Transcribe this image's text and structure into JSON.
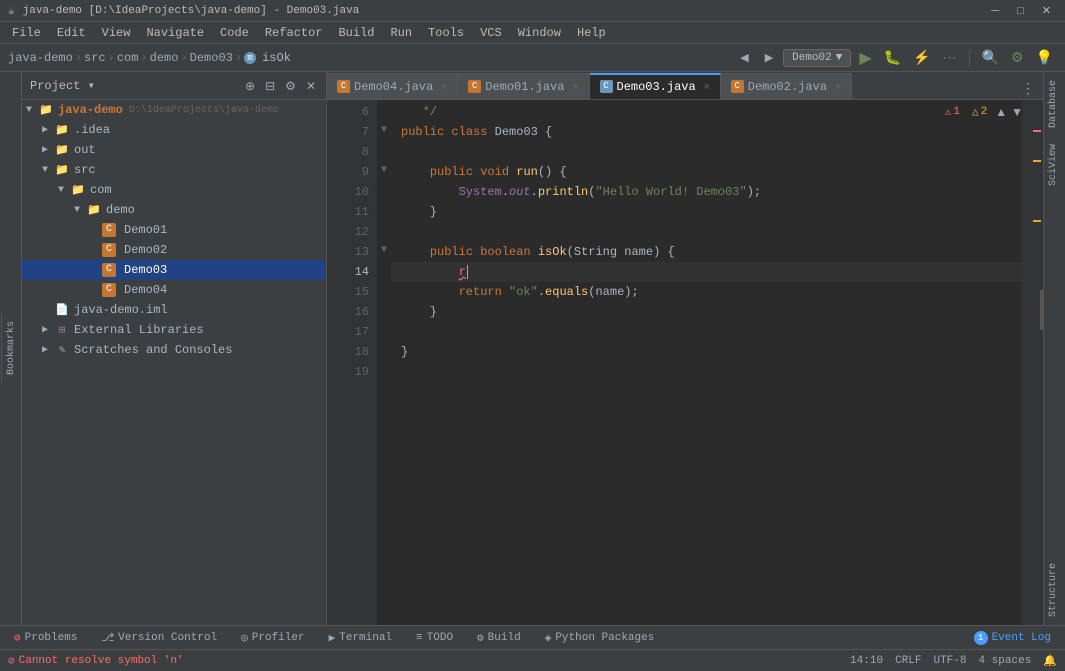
{
  "titlebar": {
    "title": "java-demo [D:\\IdeaProjects\\java-demo] - Demo03.java",
    "app_icon": "☕"
  },
  "menubar": {
    "items": [
      "File",
      "Edit",
      "View",
      "Navigate",
      "Code",
      "Refactor",
      "Build",
      "Run",
      "Tools",
      "VCS",
      "Window",
      "Help"
    ]
  },
  "navbar": {
    "breadcrumbs": [
      "java-demo",
      "src",
      "com",
      "demo",
      "Demo03",
      "isOk"
    ],
    "dropdown_label": "Demo02",
    "run_config": "Demo02"
  },
  "project_panel": {
    "title": "Project",
    "root": {
      "name": "java-demo",
      "path": "D:\\IdeaProjects\\java-demo",
      "children": [
        {
          "name": ".idea",
          "type": "folder",
          "expanded": false
        },
        {
          "name": "out",
          "type": "folder",
          "expanded": false
        },
        {
          "name": "src",
          "type": "folder",
          "expanded": true,
          "children": [
            {
              "name": "com",
              "type": "folder",
              "expanded": true,
              "children": [
                {
                  "name": "demo",
                  "type": "folder",
                  "expanded": true,
                  "children": [
                    {
                      "name": "Demo01",
                      "type": "java"
                    },
                    {
                      "name": "Demo02",
                      "type": "java"
                    },
                    {
                      "name": "Demo03",
                      "type": "java",
                      "selected": true
                    },
                    {
                      "name": "Demo04",
                      "type": "java"
                    }
                  ]
                }
              ]
            }
          ]
        },
        {
          "name": "java-demo.iml",
          "type": "module"
        },
        {
          "name": "External Libraries",
          "type": "ext",
          "expanded": false
        },
        {
          "name": "Scratches and Consoles",
          "type": "scratches",
          "expanded": false
        }
      ]
    }
  },
  "tabs": [
    {
      "name": "Demo04.java",
      "icon": "C",
      "active": false
    },
    {
      "name": "Demo01.java",
      "icon": "C",
      "active": false
    },
    {
      "name": "Demo03.java",
      "icon": "C",
      "active": true
    },
    {
      "name": "Demo02.java",
      "icon": "C",
      "active": false
    }
  ],
  "editor": {
    "filename": "Demo03.java",
    "warnings": {
      "errors": "1",
      "warnings": "2"
    },
    "current_line": 14,
    "lines": [
      {
        "num": 6,
        "content": "   */",
        "type": "comment"
      },
      {
        "num": 7,
        "content": "public class Demo03 {",
        "type": "class"
      },
      {
        "num": 8,
        "content": "",
        "type": "blank"
      },
      {
        "num": 9,
        "content": "    public void run() {",
        "type": "method"
      },
      {
        "num": 10,
        "content": "        System.out.println(\"Hello World! Demo03\");",
        "type": "code"
      },
      {
        "num": 11,
        "content": "    }",
        "type": "bracket"
      },
      {
        "num": 12,
        "content": "",
        "type": "blank"
      },
      {
        "num": 13,
        "content": "    public boolean isOk(String name) {",
        "type": "method"
      },
      {
        "num": 14,
        "content": "        r",
        "type": "code_current"
      },
      {
        "num": 15,
        "content": "        return \"ok\".equals(name);",
        "type": "code"
      },
      {
        "num": 16,
        "content": "    }",
        "type": "bracket"
      },
      {
        "num": 17,
        "content": "",
        "type": "blank"
      },
      {
        "num": 18,
        "content": "}",
        "type": "bracket"
      },
      {
        "num": 19,
        "content": "",
        "type": "blank"
      }
    ]
  },
  "bottom_tabs": [
    {
      "name": "Problems",
      "icon": "⊘",
      "icon_color": "error"
    },
    {
      "name": "Version Control",
      "icon": "⎇",
      "icon_color": "normal"
    },
    {
      "name": "Profiler",
      "icon": "◎",
      "icon_color": "normal"
    },
    {
      "name": "Terminal",
      "icon": "▶",
      "icon_color": "normal"
    },
    {
      "name": "TODO",
      "icon": "≡",
      "icon_color": "normal"
    },
    {
      "name": "Build",
      "icon": "⚙",
      "icon_color": "normal"
    },
    {
      "name": "Python Packages",
      "icon": "◈",
      "icon_color": "normal"
    },
    {
      "name": "Event Log",
      "icon": "①",
      "icon_color": "event",
      "count": "1"
    }
  ],
  "statusbar": {
    "error_msg": "Cannot resolve symbol 'n'",
    "position": "14:10",
    "line_ending": "CRLF",
    "encoding": "UTF-8",
    "indent": "4 spaces"
  },
  "right_panels": {
    "database": "Database",
    "sqldm": "SciView",
    "structure": "Structure",
    "bookmarks": "Bookmarks"
  }
}
